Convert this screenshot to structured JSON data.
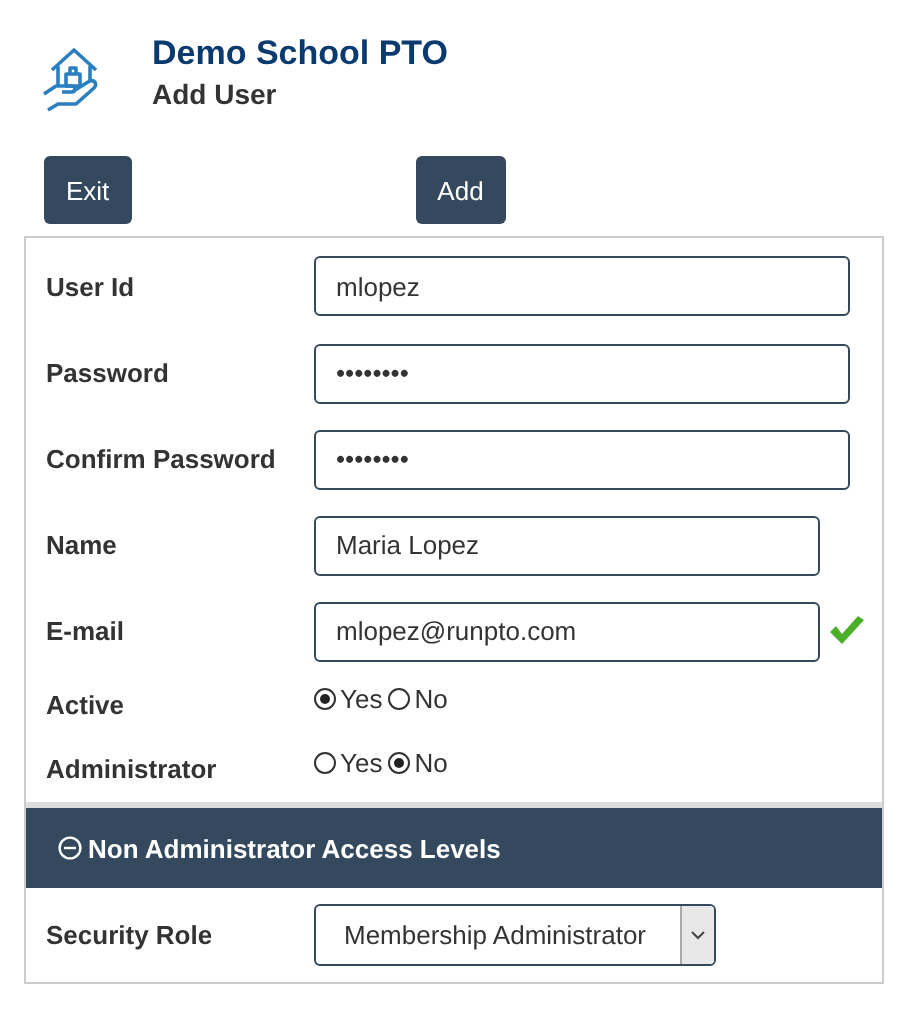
{
  "header": {
    "title": "Demo School PTO",
    "subtitle": "Add User"
  },
  "buttons": [
    {
      "label": "Exit"
    },
    {
      "label": "Add"
    }
  ],
  "fields": [
    {
      "label": "User Id",
      "value": "mlopez",
      "wide": true,
      "valid": false
    },
    {
      "label": "Password",
      "value": "••••••••",
      "wide": true,
      "valid": false
    },
    {
      "label": "Confirm Password",
      "value": "••••••••",
      "wide": true,
      "valid": false
    },
    {
      "label": "Name",
      "value": "Maria Lopez",
      "wide": false,
      "valid": false
    },
    {
      "label": "E-mail",
      "value": "mlopez@runpto.com",
      "wide": false,
      "valid": true
    }
  ],
  "radios": [
    {
      "label": "Active",
      "options": [
        {
          "label": "Yes",
          "selected": true
        },
        {
          "label": "No",
          "selected": false
        }
      ]
    },
    {
      "label": "Administrator",
      "options": [
        {
          "label": "Yes",
          "selected": false
        },
        {
          "label": "No",
          "selected": true
        }
      ]
    }
  ],
  "section": {
    "title": "Non Administrator Access Levels",
    "expanded": true
  },
  "security_role": {
    "label": "Security Role",
    "value": "Membership Administrator"
  }
}
